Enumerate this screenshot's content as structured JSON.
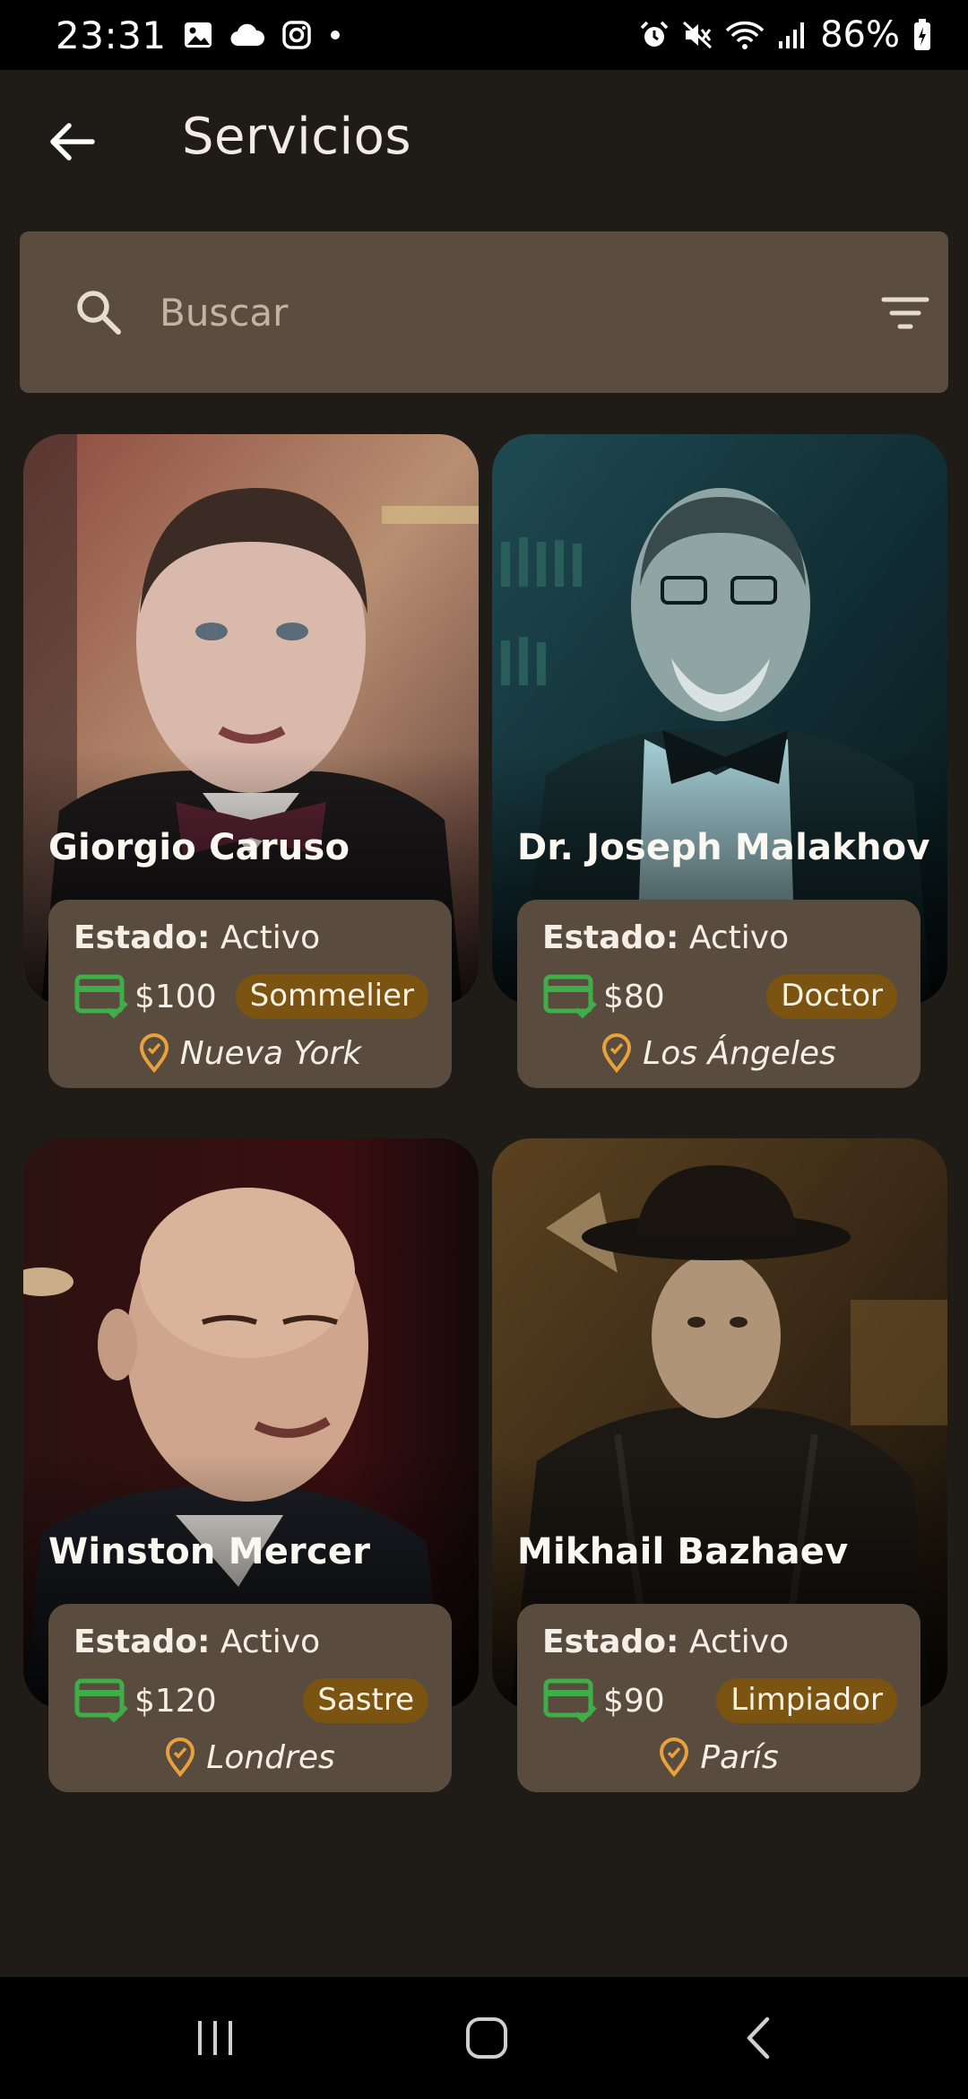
{
  "status_bar": {
    "time": "23:31",
    "left_icons": [
      "gallery-icon",
      "cloud-icon",
      "instagram-icon",
      "dot-icon"
    ],
    "right_icons": [
      "alarm-icon",
      "mute-icon",
      "wifi-icon",
      "signal-icon",
      "battery-icon"
    ],
    "battery": "86%"
  },
  "app_bar": {
    "back_icon": "arrow-left-icon",
    "title": "Servicios"
  },
  "search": {
    "placeholder": "Buscar",
    "value": "",
    "filter_icon": "filter-icon"
  },
  "labels": {
    "estado": "Estado:"
  },
  "cards": [
    {
      "name": "Giorgio Caruso",
      "estado": "Activo",
      "price": "$100",
      "role": "Sommelier",
      "location": "Nueva York"
    },
    {
      "name": "Dr. Joseph Malakhov",
      "estado": "Activo",
      "price": "$80",
      "role": "Doctor",
      "location": "Los Ángeles"
    },
    {
      "name": "Winston Mercer",
      "estado": "Activo",
      "price": "$120",
      "role": "Sastre",
      "location": "Londres"
    },
    {
      "name": "Mikhail Bazhaev",
      "estado": "Activo",
      "price": "$90",
      "role": "Limpiador",
      "location": "París"
    }
  ],
  "colors": {
    "background": "#1f1b17",
    "panel": "#594c3f",
    "badge": "#7a5410",
    "pay_icon": "#3fae49",
    "pin_icon": "#e9a23b"
  },
  "nav_bar": {
    "recents_icon": "recents-icon",
    "home_icon": "home-icon",
    "back_icon": "nav-back-icon"
  }
}
